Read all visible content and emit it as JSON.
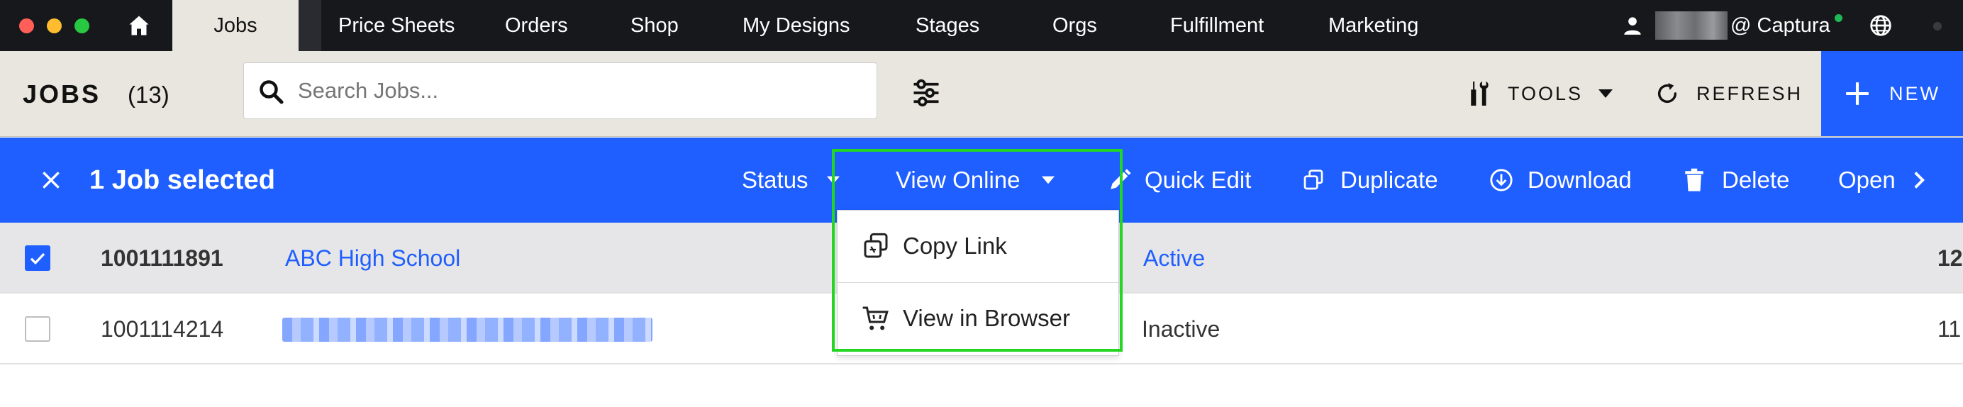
{
  "window": {
    "traffic_lights": [
      "#ff5f57",
      "#febc2e",
      "#28c840"
    ]
  },
  "nav": {
    "active_tab": "Jobs",
    "items": [
      "Price Sheets",
      "Orders",
      "Shop",
      "My Designs",
      "Stages",
      "Orgs",
      "Fulfillment",
      "Marketing"
    ],
    "org_suffix": "@ Captura"
  },
  "header": {
    "title": "JOBS",
    "count": "(13)",
    "search_placeholder": "Search Jobs...",
    "tools_label": "TOOLS",
    "refresh_label": "REFRESH",
    "new_label": "NEW"
  },
  "selection": {
    "count_label": "1 Job selected",
    "actions": {
      "status": "Status",
      "view_online": "View Online",
      "quick_edit": "Quick Edit",
      "duplicate": "Duplicate",
      "download": "Download",
      "delete": "Delete",
      "open": "Open"
    }
  },
  "rows": [
    {
      "selected": true,
      "id": "1001111891",
      "name": "ABC High School",
      "status": "Active",
      "trailing": "12"
    },
    {
      "selected": false,
      "id": "1001114214",
      "name": "",
      "status": "Inactive",
      "trailing": "11"
    }
  ],
  "dropdown": {
    "items": [
      {
        "icon": "copy-link-icon",
        "label": "Copy Link"
      },
      {
        "icon": "cart-icon",
        "label": "View in Browser"
      }
    ]
  },
  "colors": {
    "accent": "#1f5fff",
    "nav_bg": "#17181c",
    "header_bg": "#e8e6de",
    "highlight": "#22d622",
    "active_status": "#1f5fff"
  }
}
